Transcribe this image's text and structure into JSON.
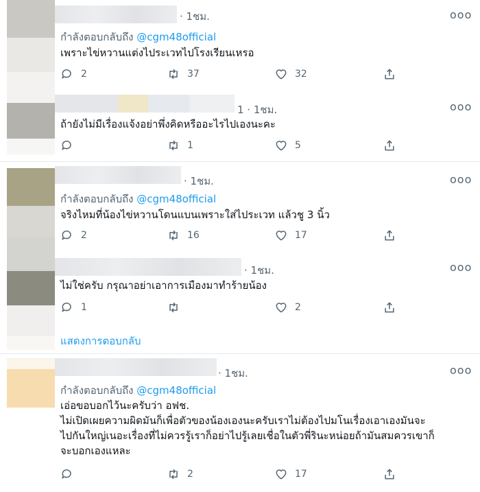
{
  "reply_prefix": "กำลังตอบกลับถึง",
  "more_glyph": "ooo",
  "tweets": [
    {
      "time": "· 1ชม.",
      "has_reply_to": true,
      "reply_handle": "@cgm48official",
      "text": "เพราะไข่หวานแต่งไประเวทไปโรงเรียนเหรอ",
      "reply_count": "2",
      "retweet_count": "37",
      "like_count": "32"
    },
    {
      "time": "1 · 1ชม.",
      "has_reply_to": false,
      "text": "ถ้ายังไม่มีเรื่องแจ้งอย่าพึ่งคิดหรืออะไรไปเองนะคะ",
      "reply_count": "",
      "retweet_count": "1",
      "like_count": "5"
    },
    {
      "time": "· 1ชม.",
      "has_reply_to": true,
      "reply_handle": "@cgm48official",
      "text": "จริงไหมที่น้องไข่หวานโดนแบนเพราะใส่ไประเวท แล้วชู 3 นิ้ว",
      "reply_count": "2",
      "retweet_count": "16",
      "like_count": "17"
    },
    {
      "time": "· 1ชม.",
      "has_reply_to": false,
      "text": "ไม่ใช่ครับ กรุณาอย่าเอาการเมืองมาทำร้ายน้อง",
      "reply_count": "1",
      "retweet_count": "",
      "like_count": "2"
    },
    {
      "time": "· 1ชม.",
      "has_reply_to": true,
      "reply_handle": "@cgm48official",
      "text_lines": [
        "เอ่อขอบอกไว้นะครับว่า อฟช.",
        "ไม่เปิดเผยความผิดมันก็เพื่อตัวของน้องเองนะครับเราไม่ต้องไปมโนเรื่องเอาเองมันจะ",
        "ไปกันใหญ่เนอะเรื่องที่ไม่ควรรู้เราก็อย่าไปรู้เลยเชื่อในตัวพี่รินะหน่อยถ้ามันสมควรเขาก็",
        "จะบอกเองแหละ"
      ],
      "reply_count": "",
      "retweet_count": "2",
      "like_count": "17"
    }
  ],
  "show_replies_label": "แสดงการตอบกลับ",
  "colors": {
    "accent": "#1d9bf0",
    "muted": "#536471",
    "text": "#0f1419",
    "divider": "#e6ecf0"
  }
}
